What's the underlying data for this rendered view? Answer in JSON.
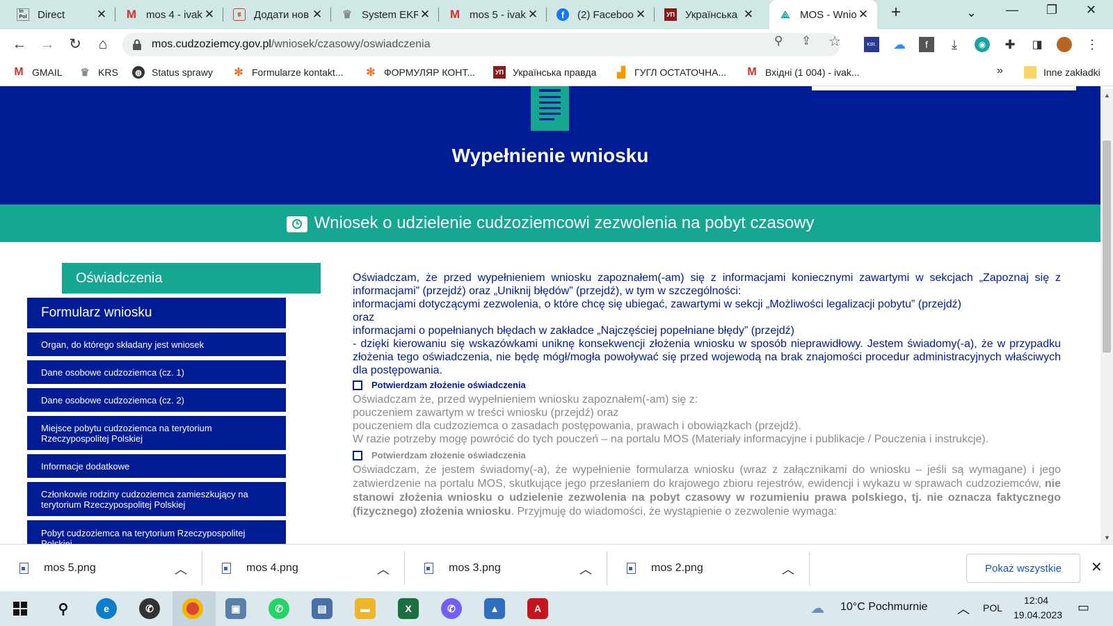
{
  "browser": {
    "tabs": [
      {
        "title": "Direct",
        "icon": "instagram-pol-icon"
      },
      {
        "title": "mos 4 - ivak",
        "icon": "gmail-icon"
      },
      {
        "title": "Додати нов",
        "icon": "add-icon"
      },
      {
        "title": "System EKR",
        "icon": "eagle-icon"
      },
      {
        "title": "mos 5 - ivak",
        "icon": "gmail-icon"
      },
      {
        "title": "(2) Faceboo",
        "icon": "facebook-icon"
      },
      {
        "title": "Українська",
        "icon": "up-icon"
      },
      {
        "title": "MOS - Wnio",
        "icon": "mos-icon"
      }
    ],
    "new_tab_label": "+",
    "url_domain": "mos.cudzoziemcy.gov.pl",
    "url_path": "/wniosek/czasowy/oswiadczenia",
    "bookmarks": [
      {
        "label": "GMAIL",
        "icon": "gmail-icon"
      },
      {
        "label": "KRS",
        "icon": "eagle-icon"
      },
      {
        "label": "Status sprawy",
        "icon": "globe-icon"
      },
      {
        "label": "Formularze kontakt...",
        "icon": "form-icon"
      },
      {
        "label": "ФОРМУЛЯР КОНТ...",
        "icon": "form-icon"
      },
      {
        "label": "Українська правда",
        "icon": "up-icon"
      },
      {
        "label": "ГУГЛ ОСТАТОЧНА...",
        "icon": "analytics-icon"
      },
      {
        "label": "Вхідні (1 004) - ivak...",
        "icon": "gmail-icon"
      }
    ],
    "bookmarks_more": "»",
    "other_bookmarks": "Inne zakładki"
  },
  "page": {
    "hero_title": "Wypełnienie wniosku",
    "banner_title": "Wniosek o udzielenie cudzoziemcowi zezwolenia na pobyt czasowy",
    "sidebar": {
      "header": "Oświadczenia",
      "section": "Formularz wniosku",
      "items": [
        "Organ, do którego składany jest wniosek",
        "Dane osobowe cudzoziemca (cz. 1)",
        "Dane osobowe cudzoziemca (cz. 2)",
        "Miejsce pobytu cudzoziemca na terytorium Rzeczypospolitej Polskiej",
        "Informacje dodatkowe",
        "Członkowie rodziny cudzoziemca zamieszkujący na terytorium Rzeczypospolitej Polskiej",
        "Pobyt cudzoziemca na terytorium Rzeczypospolitej Polskiej"
      ]
    },
    "statement1": {
      "line1": "Oświadczam, że przed wypełnieniem wniosku zapoznałem(-am) się z informacjami koniecznymi zawartymi w sekcjach „Zapoznaj się z informacjami” (przejdź) oraz „Uniknij błędów” (przejdź), w tym w szczególności:",
      "line2": "informacjami dotyczącymi zezwolenia, o które chcę się ubiegać, zawartymi w sekcji „Możliwości legalizacji pobytu” (przejdź)",
      "line3": "oraz",
      "line4": "informacjami o popełnianych błędach w zakładce „Najczęściej popełniane błędy” (przejdź)",
      "line5": "- dzięki kierowaniu się wskazówkami uniknę konsekwencji złożenia wniosku w sposób nieprawidłowy. Jestem świadomy(-a), że w przypadku złożenia tego oświadczenia, nie będę mógł/mogła powoływać się przed wojewodą na brak znajomości procedur administracyjnych właściwych dla postępowania."
    },
    "confirm1": "Potwierdzam złożenie oświadczenia",
    "statement2": {
      "line1": "Oświadczam że, przed wypełnieniem wniosku zapoznałem(-am) się z:",
      "line2": "pouczeniem zawartym w treści wniosku (przejdź) oraz",
      "line3": "pouczeniem dla cudzoziemca o zasadach postępowania, prawach i obowiązkach (przejdź).",
      "line4": "W razie potrzeby mogę powrócić do tych pouczeń – na portalu MOS (Materiały informacyjne i publikacje / Pouczenia i instrukcje)."
    },
    "confirm2": "Potwierdzam złożenie oświadczenia",
    "statement3": {
      "part1": "Oświadczam, że jestem świadomy(-a), że wypełnienie formularza wniosku (wraz z załącznikami do wniosku – jeśli są wymagane) i jego zatwierdzenie na portalu MOS, skutkujące jego przesłaniem do krajowego zbioru rejestrów, ewidencji i wykazu w sprawach cudzoziemców, ",
      "bold": "nie stanowi złożenia wniosku o udzielenie zezwolenia na pobyt czasowy w rozumieniu prawa polskiego, tj. nie oznacza faktycznego (fizycznego) złożenia wniosku",
      "part2": ". Przyjmuję do wiadomości, że wystąpienie o zezwolenie wymaga:"
    }
  },
  "downloads": {
    "items": [
      "mos 5.png",
      "mos 4.png",
      "mos 3.png",
      "mos 2.png"
    ],
    "show_all": "Pokaż wszystkie",
    "close": "✕"
  },
  "taskbar": {
    "weather": "10°C  Pochmurnie",
    "lang": "POL",
    "time": "12:04",
    "date": "19.04.2023"
  },
  "colors": {
    "navy": "#001c94",
    "teal": "#16a793",
    "tab_strip": "#cfe8e6"
  }
}
